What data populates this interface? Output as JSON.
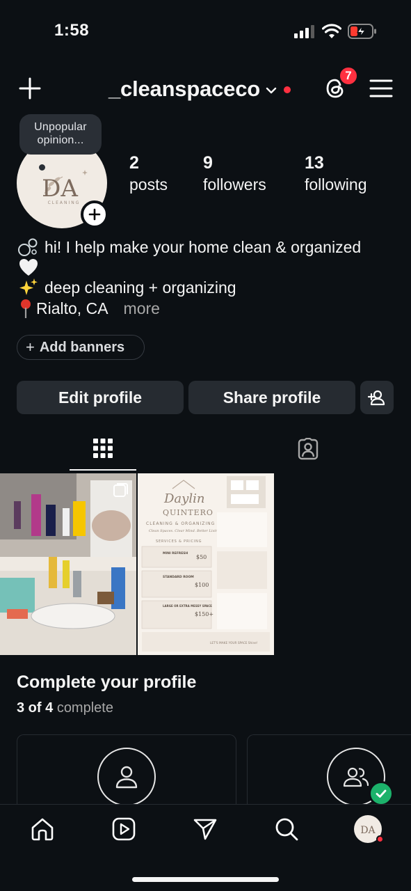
{
  "status_bar": {
    "time": "1:58"
  },
  "header": {
    "username": "_cleanspaceco",
    "notification_count": "7"
  },
  "profile": {
    "note": "Unpopular opinion...",
    "avatar_text": "DA",
    "avatar_subtext": "CLEANING",
    "stats": [
      {
        "value": "2",
        "label": "posts"
      },
      {
        "value": "9",
        "label": "followers"
      },
      {
        "value": "13",
        "label": "following"
      }
    ],
    "bio": {
      "line1": "hi! I help make your home clean & organized",
      "line2": "deep cleaning + organizing",
      "line3": "Rialto, CA",
      "more": "more"
    },
    "add_banners": "Add banners",
    "buttons": {
      "edit": "Edit profile",
      "share": "Share profile"
    }
  },
  "posts": [
    {
      "icon": "photo-carousel"
    },
    {
      "title_script": "Daylin",
      "title_name": "QUINTERO",
      "subtitle": "CLEANING & ORGANIZING",
      "tagline": "Clean Spaces. Clear Mind. Better Living.",
      "section": "SERVICES & PRICING",
      "prices": [
        {
          "name": "MINI REFRESH",
          "price": "$50"
        },
        {
          "name": "STANDARD ROOM",
          "price": "$100"
        },
        {
          "name": "LARGE OR EXTRA MESSY SPACE",
          "price": "$150+"
        }
      ],
      "footer": "LET'S MAKE YOUR SPACE Shine!"
    }
  ],
  "complete_profile": {
    "title": "Complete your profile",
    "progress_bold": "3 of 4",
    "progress_rest": "complete"
  },
  "colors": {
    "background": "#0c1014",
    "button": "#262b31",
    "accent_red": "#ff3040",
    "check_green": "#1cb26b"
  }
}
